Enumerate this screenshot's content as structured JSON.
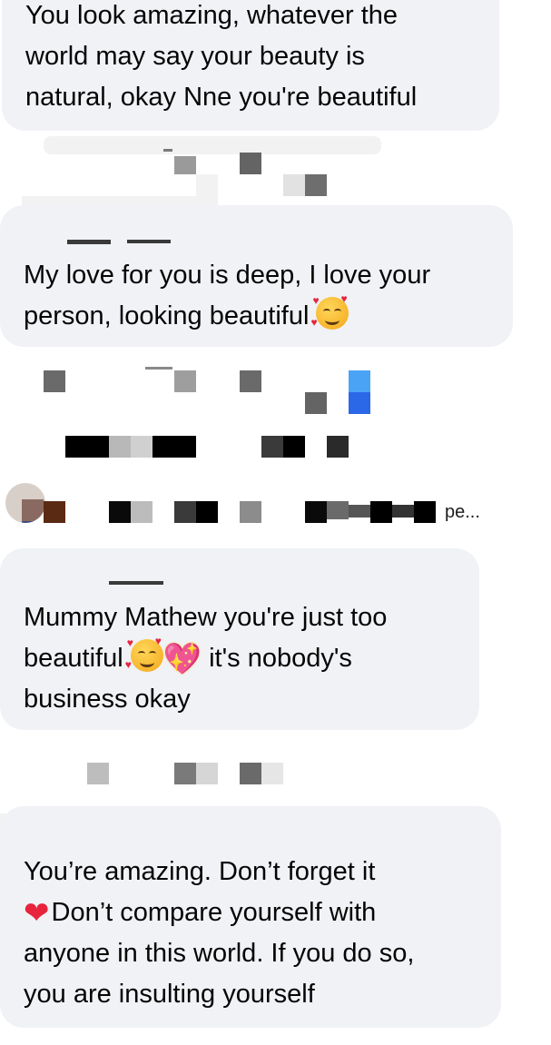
{
  "comments": [
    {
      "id": "c1",
      "text": "You look amazing, whatever the\nworld may say your beauty is\nnatural, okay Nne you're beautiful"
    },
    {
      "id": "c2",
      "text_before": "My love for you is deep, I love your\nperson, looking beautiful ",
      "emoji": "smiling-face-with-hearts"
    },
    {
      "id": "c3",
      "name_fragment": "pe...",
      "line1": "Mummy Mathew you're just too",
      "line2_before": "beautiful ",
      "line2_after": " it's nobody's",
      "line3": "business okay",
      "emojis": [
        "smiling-face-with-hearts",
        "sparkling-heart"
      ]
    },
    {
      "id": "c4",
      "line1": "You’re amazing. Don’t forget it",
      "line2_after": "Don’t compare yourself with",
      "line3": "anyone in this world. If you do so,",
      "line4": "you are insulting yourself",
      "emoji": "red-heart"
    }
  ],
  "colors": {
    "bubble": "#f0f2f5",
    "text": "#050505",
    "heart": "#e8243d"
  }
}
